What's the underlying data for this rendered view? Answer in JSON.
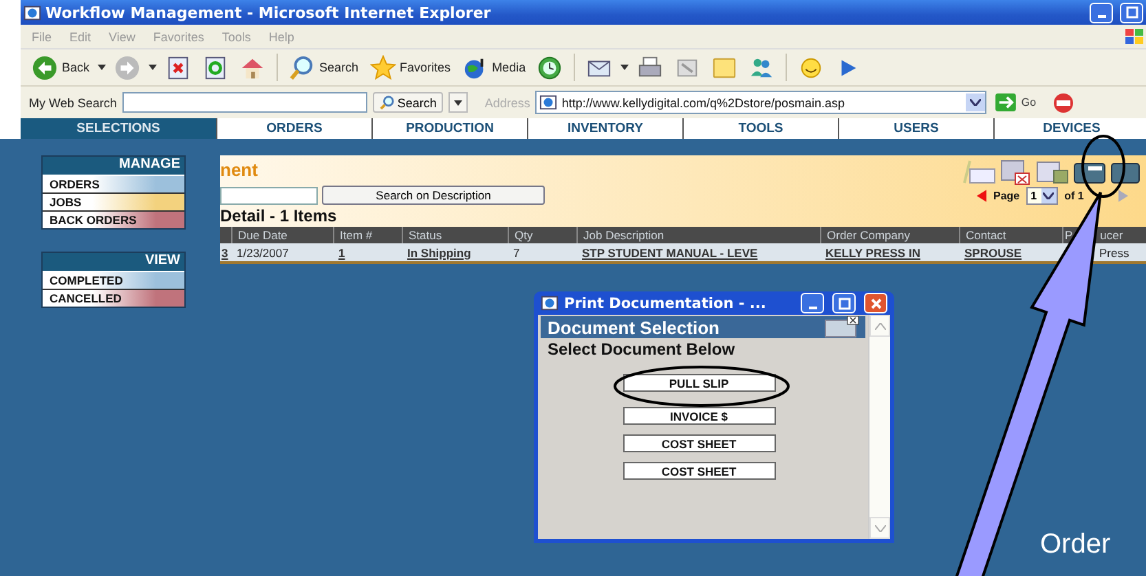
{
  "window": {
    "title": "Workflow Management - Microsoft Internet Explorer"
  },
  "menu": [
    "File",
    "Edit",
    "View",
    "Favorites",
    "Tools",
    "Help"
  ],
  "toolbar": [
    {
      "kind": "back",
      "label": "Back"
    },
    {
      "kind": "forward"
    },
    {
      "kind": "stop"
    },
    {
      "kind": "refresh"
    },
    {
      "kind": "home"
    },
    {
      "kind": "search",
      "label": "Search"
    },
    {
      "kind": "favorites",
      "label": "Favorites"
    },
    {
      "kind": "media",
      "label": "Media"
    },
    {
      "kind": "history"
    },
    {
      "kind": "mail"
    },
    {
      "kind": "print"
    },
    {
      "kind": "edit"
    },
    {
      "kind": "note"
    },
    {
      "kind": "messenger"
    },
    {
      "kind": "smiley"
    },
    {
      "kind": "play"
    }
  ],
  "address_bar": {
    "search_label": "My Web Search",
    "search_button": "Search",
    "address_label": "Address",
    "url": "http://www.kellydigital.com/q%2Dstore/posmain.asp",
    "go": "Go"
  },
  "nav_tabs": [
    {
      "label": "SELECTIONS",
      "selected": true
    },
    {
      "label": "ORDERS",
      "selected": false
    },
    {
      "label": "PRODUCTION",
      "selected": false
    },
    {
      "label": "INVENTORY",
      "selected": false
    },
    {
      "label": "TOOLS",
      "selected": false
    },
    {
      "label": "USERS",
      "selected": false
    },
    {
      "label": "DEVICES",
      "selected": false
    }
  ],
  "sidebar": [
    {
      "heading": "MANAGE",
      "items": [
        {
          "label": "ORDERS",
          "color": "#9cc0dc"
        },
        {
          "label": "JOBS",
          "color": "#f3d27e"
        },
        {
          "label": "BACK ORDERS",
          "color": "#c0737c"
        }
      ]
    },
    {
      "heading": "VIEW",
      "items": [
        {
          "label": "COMPLETED",
          "color": "#9cc0dc"
        },
        {
          "label": "CANCELLED",
          "color": "#c0737c"
        }
      ]
    }
  ],
  "panel": {
    "title": "nent",
    "search_button": "Search on Description",
    "detail_title": "Detail - 1 Items",
    "page_label": "Page",
    "page_value": "1",
    "page_total": "of 1"
  },
  "table": {
    "columns": [
      "Due Date",
      "Item #",
      "Status",
      "Qty",
      "Job Description",
      "Order Company",
      "Contact",
      [
        "P",
        "ucer"
      ]
    ],
    "rows": [
      {
        "ref": "3",
        "cells": [
          {
            "text": "1/23/2007",
            "link": false
          },
          {
            "text": "1",
            "link": true
          },
          {
            "text": "In Shipping",
            "link": true
          },
          {
            "text": "7",
            "link": false
          },
          {
            "text": "STP STUDENT MANUAL - LEVE",
            "link": true
          },
          {
            "text": "KELLY PRESS IN",
            "link": true
          },
          {
            "text": "SPROUSE",
            "link": true
          },
          {
            "text": "Press",
            "link": false
          }
        ]
      }
    ]
  },
  "popup": {
    "title": "Print Documentation - ...",
    "heading": "Document Selection",
    "prompt": "Select Document Below",
    "buttons": [
      "PULL SLIP",
      "INVOICE $",
      "COST SHEET",
      "COST SHEET"
    ]
  },
  "annotation": {
    "label": "Order"
  }
}
